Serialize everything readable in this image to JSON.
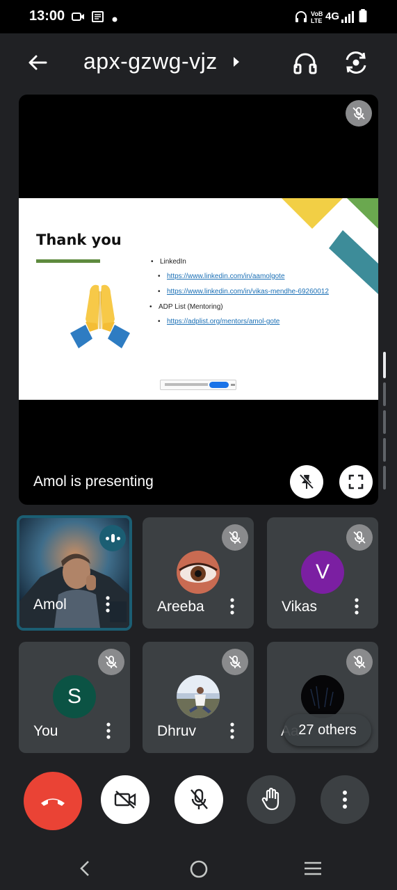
{
  "status_bar": {
    "time": "13:00",
    "network": "4G",
    "volte": "VoB\nLTE"
  },
  "header": {
    "meeting_code": "apx-gzwg-vjz"
  },
  "presentation": {
    "label": "Amol is presenting",
    "slide": {
      "title": "Thank you",
      "items": [
        {
          "level": 1,
          "text": "LinkedIn"
        },
        {
          "level": 2,
          "text": "https://www.linkedin.com/in/aamolgote"
        },
        {
          "level": 2,
          "text": "https://www.linkedin.com/in/vikas-mendhe-69260012"
        },
        {
          "level": 1,
          "text": "ADP List (Mentoring)"
        },
        {
          "level": 2,
          "text": "https://adplist.org/mentors/amol-gote"
        }
      ]
    }
  },
  "participants": [
    {
      "name": "Amol",
      "avatar_letter": "",
      "avatar_color": "",
      "speaking": true,
      "muted": false
    },
    {
      "name": "Areeba",
      "avatar_letter": "",
      "avatar_color": "",
      "speaking": false,
      "muted": true
    },
    {
      "name": "Vikas",
      "avatar_letter": "V",
      "avatar_color": "#7b1fa2",
      "speaking": false,
      "muted": true
    },
    {
      "name": "You",
      "avatar_letter": "S",
      "avatar_color": "#0b5344",
      "speaking": false,
      "muted": true
    },
    {
      "name": "Dhruv",
      "avatar_letter": "",
      "avatar_color": "",
      "speaking": false,
      "muted": true
    },
    {
      "name": "Aa",
      "avatar_letter": "",
      "avatar_color": "",
      "speaking": false,
      "muted": true
    }
  ],
  "others_count_label": "27 others",
  "colors": {
    "background": "#202124",
    "tile": "#3c4043",
    "end_call": "#ea4335",
    "active_border": "#1b5e73"
  }
}
